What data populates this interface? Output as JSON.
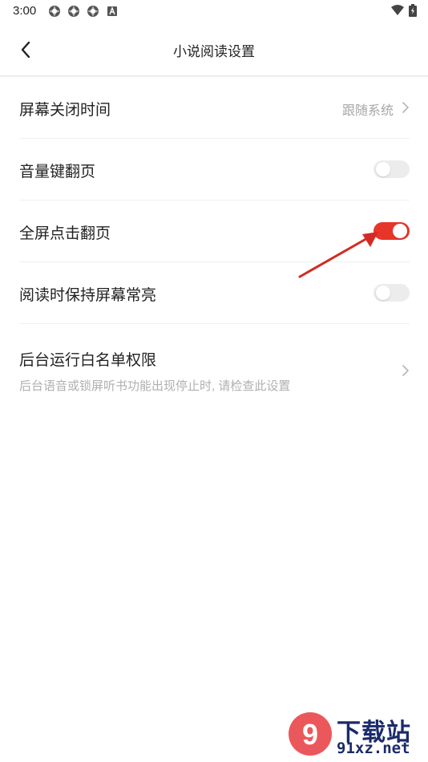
{
  "status_bar": {
    "time": "3:00",
    "icons": [
      "app-icon",
      "app-icon",
      "app-icon",
      "a-icon"
    ],
    "right_icons": [
      "wifi-icon",
      "battery-icon"
    ]
  },
  "nav": {
    "title": "小说阅读设置",
    "back_icon": "chevron-left-icon"
  },
  "settings": {
    "screen_off": {
      "label": "屏幕关闭时间",
      "value": "跟随系统"
    },
    "volume_turn": {
      "label": "音量键翻页",
      "enabled": false
    },
    "fullscreen_tap": {
      "label": "全屏点击翻页",
      "enabled": true
    },
    "keep_screen_on": {
      "label": "阅读时保持屏幕常亮",
      "enabled": false
    },
    "background_whitelist": {
      "label": "后台运行白名单权限",
      "description": "后台语音或锁屏听书功能出现停止时, 请检查此设置"
    }
  },
  "colors": {
    "accent": "#e8352a",
    "toggle_off": "#ececec",
    "secondary_text": "#a6a6a6"
  },
  "watermark": {
    "logo_text": "9",
    "line1": "下载站",
    "line2": "91xz.net"
  }
}
